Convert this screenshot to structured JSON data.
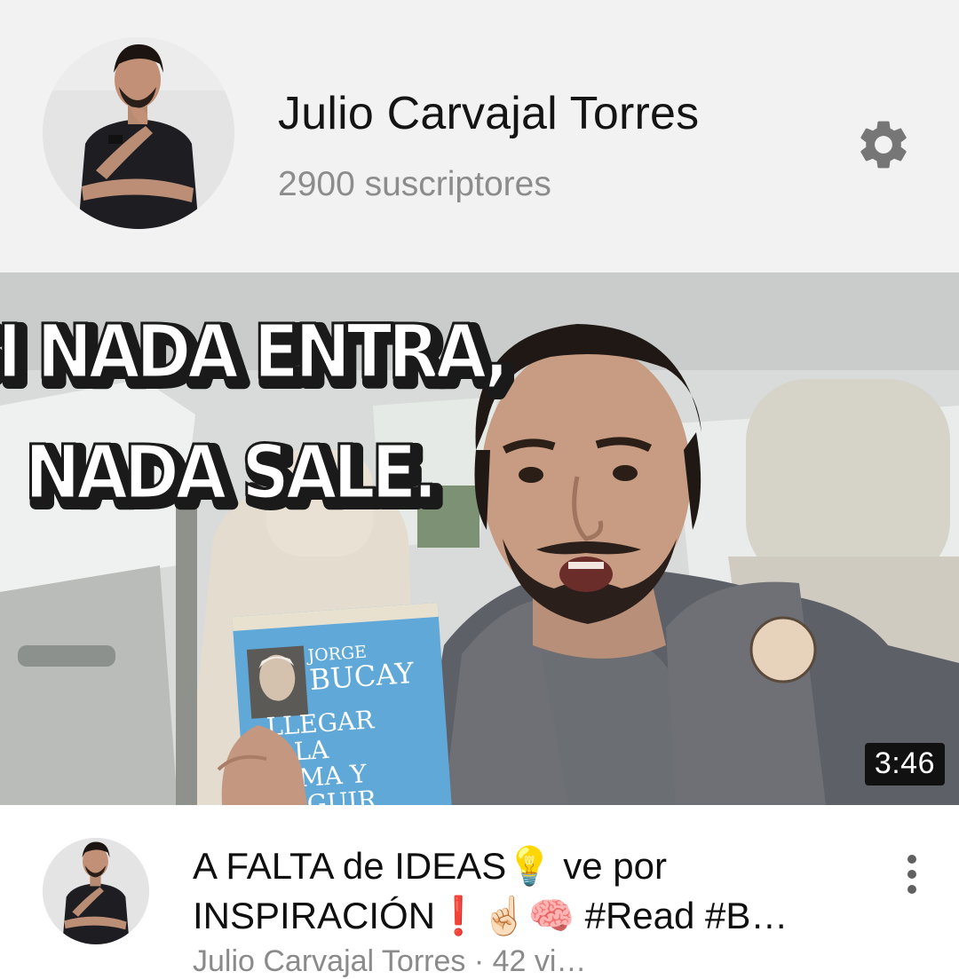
{
  "channel": {
    "name": "Julio Carvajal Torres",
    "subscribers": "2900 suscriptores",
    "settings_icon": "gear-icon"
  },
  "thumbnail": {
    "overlay_line1": "SI NADA ENTRA,",
    "overlay_line2": "NADA SALE.",
    "book_author_first": "JORGE",
    "book_author_last": "BUCAY",
    "book_title_lines": [
      "LLEGAR",
      "A LA",
      "CIMA Y",
      "SEGUIR"
    ],
    "duration": "3:46"
  },
  "video": {
    "title_line1": "A FALTA de IDEAS💡 ve por",
    "title_line2": "INSPIRACIÓN❗☝🏻🧠 #Read #B…",
    "meta_partial": "Julio Carvajal Torres · 42 vi…",
    "menu_icon": "more-vert-icon"
  },
  "colors": {
    "header_bg": "#f2f2f2",
    "gear": "#767676",
    "subs_text": "#8c8c8c"
  }
}
